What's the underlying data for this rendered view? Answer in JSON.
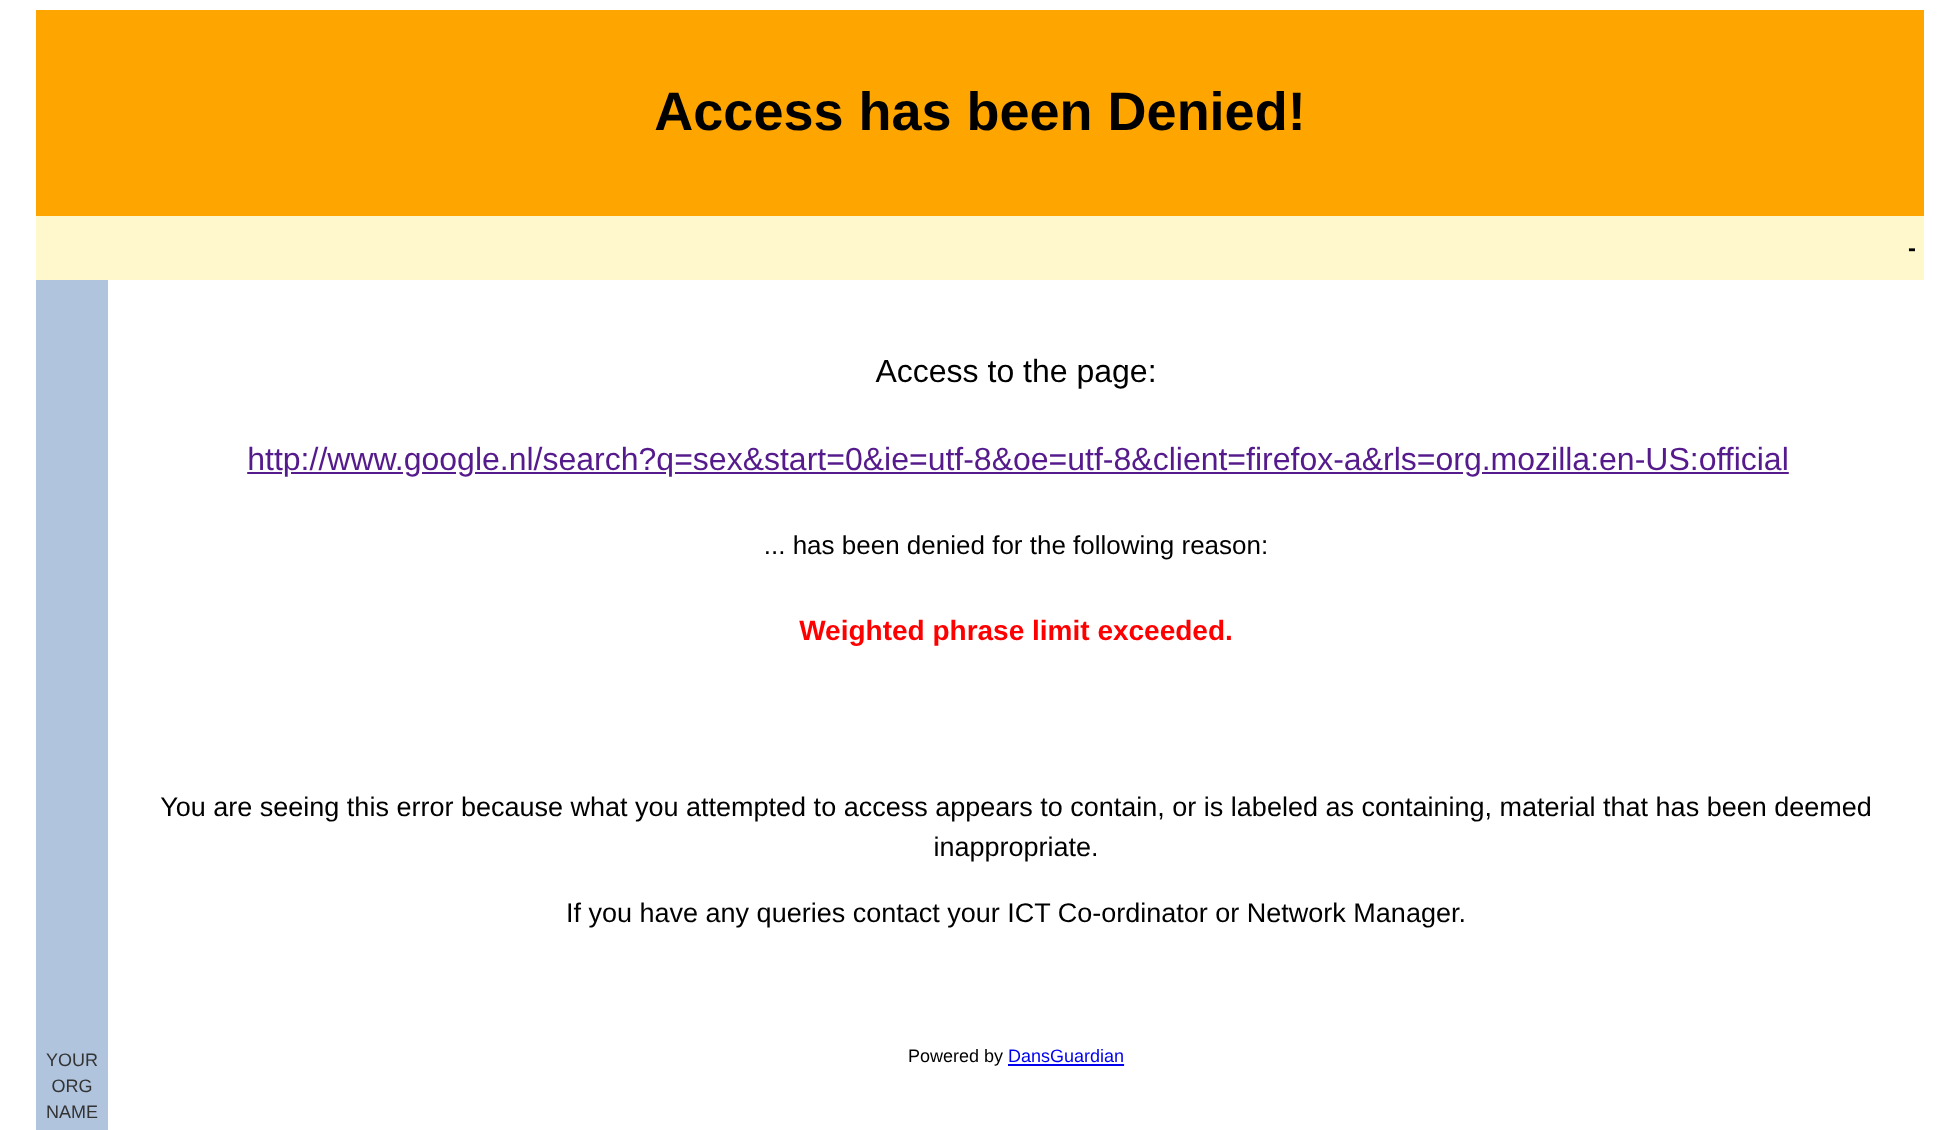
{
  "header": {
    "title": "Access has been Denied!"
  },
  "info_bar": {
    "text": "-"
  },
  "sidebar": {
    "org_name": "YOUR ORG NAME"
  },
  "content": {
    "intro": "Access to the page:",
    "url": "http://www.google.nl/search?q=sex&start=0&ie=utf-8&oe=utf-8&client=firefox-a&rls=org.mozilla:en-US:official",
    "denied_text": "... has been denied for the following reason:",
    "reason": "Weighted phrase limit exceeded.",
    "explanation": "You are seeing this error because what you attempted to access appears to contain, or is labeled as containing, material that has been deemed inappropriate.",
    "contact": "If you have any queries contact your ICT Co-ordinator or Network Manager.",
    "powered_by": "Powered by",
    "powered_link": "DansGuardian"
  }
}
